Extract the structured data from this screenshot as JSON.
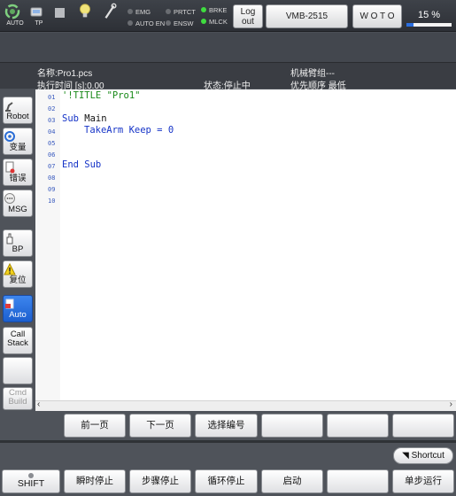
{
  "topbar": {
    "auto_label": "AUTO",
    "tp_label": "TP",
    "indicators": {
      "emg": "EMG",
      "auto_en": "AUTO EN",
      "prtct": "PRTCT",
      "ensw": "ENSW",
      "brke": "BRKE",
      "mlck": "MLCK"
    },
    "logout_line1": "Log",
    "logout_line2": "out",
    "robot_model": "VMB-2515",
    "woto": "W O T O",
    "speed_text": "15 %",
    "speed_value": 0.15,
    "on_color": "#3fdc3f"
  },
  "info": {
    "name": "名称:Pro1.pcs",
    "exec_time": "执行时间 [s]:0.00",
    "arm_group": "机械臂组---",
    "state": "状态:停止中",
    "priority": "优先顺序 最低"
  },
  "sidebar": {
    "robot": "Robot",
    "variable": "变量",
    "error": "错误",
    "msg": "MSG",
    "bp": "BP",
    "reset": "复位",
    "auto": "Auto",
    "call_stack_1": "Call",
    "call_stack_2": "Stack",
    "cmd_build_1": "Cmd",
    "cmd_build_2": "Build"
  },
  "editor": {
    "line_numbers": [
      "01",
      "02",
      "03",
      "04",
      "05",
      "06",
      "07",
      "08",
      "09",
      "10"
    ],
    "line1": "'!TITLE \"Pro1\"",
    "line3_kw": "Sub",
    "line3_name": " Main",
    "line4_kw": "TakeArm Keep = 0",
    "line7_kw": "End Sub"
  },
  "function_row": {
    "prev_page": "前一页",
    "next_page": "下一页",
    "select_number": "选择编号"
  },
  "shortcut_label": "Shortcut",
  "action_row": {
    "shift": "SHIFT",
    "instant_stop": "瞬时停止",
    "step_stop": "步骤停止",
    "cycle_stop": "循环停止",
    "start": "启动",
    "single_step": "单步运行"
  }
}
